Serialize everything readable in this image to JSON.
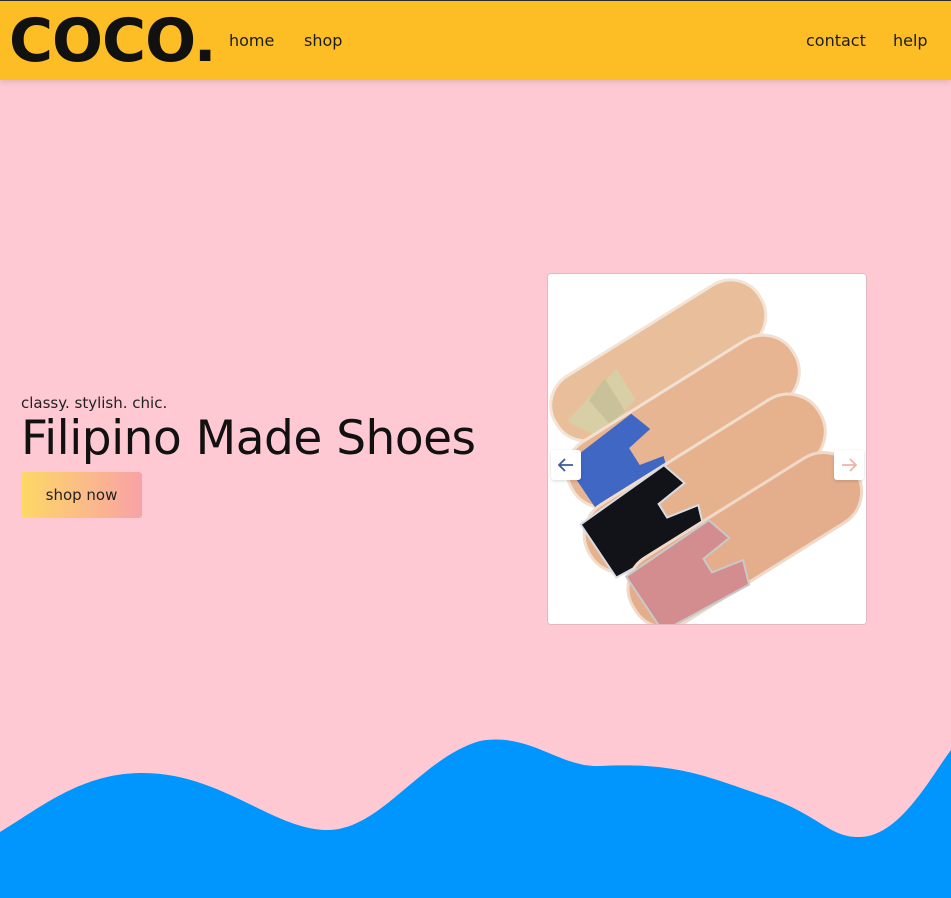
{
  "brand": {
    "logo": "COCO."
  },
  "nav": {
    "home": "home",
    "shop": "shop",
    "contact": "contact",
    "help": "help"
  },
  "hero": {
    "tagline": "classy. stylish. chic.",
    "title": "Filipino Made Shoes",
    "cta_label": "shop now"
  },
  "carousel": {
    "prev_icon": "arrow-left-icon",
    "next_icon": "arrow-right-icon",
    "slide_image": "sandals-photo"
  },
  "colors": {
    "navbar": "#fdbe25",
    "page_background": "#ffc9d4",
    "wave": "#0096fe",
    "cta_gradient_start": "#fdd866",
    "cta_gradient_end": "#f8a2a6"
  }
}
